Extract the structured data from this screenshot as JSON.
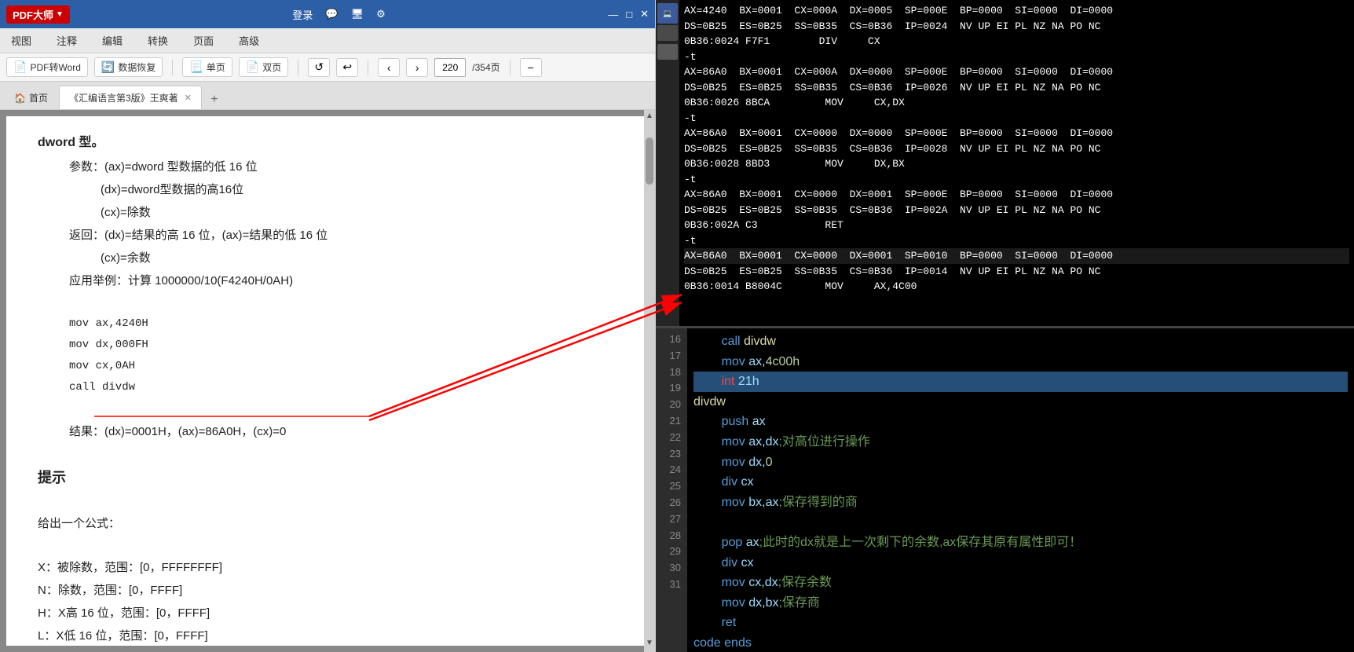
{
  "app": {
    "name": "PDF大师",
    "logo_arrow": "▼"
  },
  "toolbar_top": {
    "login": "登录",
    "chat": "💬",
    "screenshot": "🖥",
    "settings": "⚙",
    "minimize": "—",
    "maximize": "□",
    "close": "✕"
  },
  "menubar": {
    "items": [
      "视图",
      "注释",
      "编辑",
      "转换",
      "页面",
      "高级"
    ]
  },
  "actionbar": {
    "pdf_to_word": "PDF转Word",
    "data_recovery": "数据恢复",
    "single_page": "单页",
    "double_page": "双页",
    "current_page": "220",
    "total_pages": "/354页"
  },
  "tabs": {
    "home": "首页",
    "document": "《汇编语言第3版》王爽著",
    "add": "+"
  },
  "pdf_content": {
    "lines": [
      {
        "text": "dword 型。",
        "style": "bold"
      },
      {
        "text": "参数：(ax)=dword 型数据的低 16 位",
        "style": "indent1"
      },
      {
        "text": "(dx)=dword型数据的高16位",
        "style": "indent2"
      },
      {
        "text": "(cx)=除数",
        "style": "indent2"
      },
      {
        "text": "返回：(dx)=结果的高 16 位，(ax)=结果的低 16 位",
        "style": "indent1"
      },
      {
        "text": "(cx)=余数",
        "style": "indent2"
      },
      {
        "text": "应用举例：计算 1000000/10(F4240H/0AH)",
        "style": "indent1"
      },
      {
        "text": "mov  ax,4240H",
        "style": "code indent1"
      },
      {
        "text": "mov  dx,000FH",
        "style": "code indent1"
      },
      {
        "text": "mov  cx,0AH",
        "style": "code indent1"
      },
      {
        "text": "call divdw",
        "style": "code indent1"
      },
      {
        "text": "结果：(dx)=0001H，(ax)=86A0H，(cx)=0",
        "style": "indent1"
      },
      {
        "text": "提示",
        "style": "bold heading"
      },
      {
        "text": "给出一个公式：",
        "style": "normal"
      },
      {
        "text": "X：被除数，范围：[0，FFFFFFFF]",
        "style": "normal"
      },
      {
        "text": "N：除数，范围：[0，FFFF]",
        "style": "normal"
      },
      {
        "text": "H：X高 16 位，范围：[0，FFFF]",
        "style": "normal"
      },
      {
        "text": "L：X低 16 位，范围：[0，FFFF]",
        "style": "normal"
      }
    ]
  },
  "debugger": {
    "blocks": [
      {
        "line1": "AX=4240  BX=0001  CX=000A  DX=0005  SP=000E  BP=0000  SI=0000  DI=0000",
        "line2": "DS=0B25  ES=0B25  SS=0B35  CS=0B36  IP=0024  NV UP EI PL NZ NA PO NC",
        "line3": "0B36:0024 F7F1        DIV     CX",
        "prompt": "-t"
      },
      {
        "line1": "AX=86A0  BX=0001  CX=000A  DX=0000  SP=000E  BP=0000  SI=0000  DI=0000",
        "line2": "DS=0B25  ES=0B25  SS=0B35  CS=0B36  IP=0026  NV UP EI PL NZ NA PO NC",
        "line3": "0B36:0026 8BCA         MOV     CX,DX",
        "prompt": "-t"
      },
      {
        "line1": "AX=86A0  BX=0001  CX=0000  DX=0000  SP=000E  BP=0000  SI=0000  DI=0000",
        "line2": "DS=0B25  ES=0B25  SS=0B35  CS=0B36  IP=0028  NV UP EI PL NZ NA PO NC",
        "line3": "0B36:0028 8BD3         MOV     DX,BX",
        "prompt": "-t"
      },
      {
        "line1": "AX=86A0  BX=0001  CX=0000  DX=0001  SP=000E  BP=0000  SI=0000  DI=0000",
        "line2": "DS=0B25  ES=0B25  SS=0B35  CS=0B36  IP=002A  NV UP EI PL NZ NA PO NC",
        "line3": "0B36:002A C3           RET",
        "prompt": "-t"
      },
      {
        "line1": "AX=86A0  BX=0001  CX=0000  DX=0001  SP=0010  BP=0000  SI=0000  DI=0000",
        "line2": "DS=0B25  ES=0B25  SS=0B35  CS=0B36  IP=0014  NV UP EI PL NZ NA PO NC",
        "line3": "0B36:0014 B8004C       MOV     AX,4C00",
        "prompt": ""
      }
    ]
  },
  "code_editor": {
    "lines": [
      {
        "num": "16",
        "content": "        call divdw",
        "highlight": false,
        "parts": [
          {
            "text": "        ",
            "cls": ""
          },
          {
            "text": "call",
            "cls": "kw-blue"
          },
          {
            "text": " divdw",
            "cls": "kw-yellow"
          }
        ]
      },
      {
        "num": "17",
        "content": "        mov ax,4c00h",
        "highlight": false,
        "parts": [
          {
            "text": "        ",
            "cls": ""
          },
          {
            "text": "mov",
            "cls": "kw-blue"
          },
          {
            "text": " ax,",
            "cls": "kw-cyan"
          },
          {
            "text": "4c00h",
            "cls": "kw-number"
          }
        ]
      },
      {
        "num": "18",
        "content": "        int 21h",
        "highlight": true,
        "parts": [
          {
            "text": "        ",
            "cls": ""
          },
          {
            "text": "int",
            "cls": "kw-red"
          },
          {
            "text": " 21h",
            "cls": "kw-number"
          }
        ]
      },
      {
        "num": "19",
        "content": "divdw:",
        "highlight": false,
        "parts": [
          {
            "text": "divdw",
            "cls": "kw-yellow"
          },
          {
            "text": ":",
            "cls": ""
          }
        ]
      },
      {
        "num": "20",
        "content": "        push ax",
        "highlight": false,
        "parts": [
          {
            "text": "        ",
            "cls": ""
          },
          {
            "text": "push",
            "cls": "kw-blue"
          },
          {
            "text": " ax",
            "cls": "kw-cyan"
          }
        ]
      },
      {
        "num": "21",
        "content": "        mov ax,dx;对高位进行操作",
        "highlight": false,
        "parts": [
          {
            "text": "        ",
            "cls": ""
          },
          {
            "text": "mov",
            "cls": "kw-blue"
          },
          {
            "text": " ax,dx",
            "cls": "kw-cyan"
          },
          {
            "text": ";对高位进行操作",
            "cls": "kw-comment"
          }
        ]
      },
      {
        "num": "22",
        "content": "        mov dx,0",
        "highlight": false,
        "parts": [
          {
            "text": "        ",
            "cls": ""
          },
          {
            "text": "mov",
            "cls": "kw-blue"
          },
          {
            "text": " dx,",
            "cls": "kw-cyan"
          },
          {
            "text": "0",
            "cls": "kw-number"
          }
        ]
      },
      {
        "num": "23",
        "content": "        div cx",
        "highlight": false,
        "parts": [
          {
            "text": "        ",
            "cls": ""
          },
          {
            "text": "div",
            "cls": "kw-blue"
          },
          {
            "text": " cx",
            "cls": "kw-cyan"
          }
        ]
      },
      {
        "num": "24",
        "content": "        mov bx,ax;保存得到的商",
        "highlight": false,
        "parts": [
          {
            "text": "        ",
            "cls": ""
          },
          {
            "text": "mov",
            "cls": "kw-blue"
          },
          {
            "text": " bx,ax",
            "cls": "kw-cyan"
          },
          {
            "text": ";保存得到的商",
            "cls": "kw-comment"
          }
        ]
      },
      {
        "num": "25",
        "content": "",
        "highlight": false,
        "parts": []
      },
      {
        "num": "26",
        "content": "        pop ax;此时的dx就是上一次剩下的余数,ax保存其原有属性即可！",
        "highlight": false,
        "parts": [
          {
            "text": "        ",
            "cls": ""
          },
          {
            "text": "pop",
            "cls": "kw-blue"
          },
          {
            "text": " ax",
            "cls": "kw-cyan"
          },
          {
            "text": ";此时的dx就是上一次剩下的余数,ax保存其原有属性即可！",
            "cls": "kw-comment"
          }
        ]
      },
      {
        "num": "27",
        "content": "        div cx",
        "highlight": false,
        "parts": [
          {
            "text": "        ",
            "cls": ""
          },
          {
            "text": "div",
            "cls": "kw-blue"
          },
          {
            "text": " cx",
            "cls": "kw-cyan"
          }
        ]
      },
      {
        "num": "28",
        "content": "        mov cx,dx;保存余数",
        "highlight": false,
        "parts": [
          {
            "text": "        ",
            "cls": ""
          },
          {
            "text": "mov",
            "cls": "kw-blue"
          },
          {
            "text": " cx,dx",
            "cls": "kw-cyan"
          },
          {
            "text": ";保存余数",
            "cls": "kw-comment"
          }
        ]
      },
      {
        "num": "29",
        "content": "        mov dx,bx;保存商",
        "highlight": false,
        "parts": [
          {
            "text": "        ",
            "cls": ""
          },
          {
            "text": "mov",
            "cls": "kw-blue"
          },
          {
            "text": " dx,bx",
            "cls": "kw-cyan"
          },
          {
            "text": ";保存商",
            "cls": "kw-comment"
          }
        ]
      },
      {
        "num": "30",
        "content": "        ret",
        "highlight": false,
        "parts": [
          {
            "text": "        ",
            "cls": ""
          },
          {
            "text": "ret",
            "cls": "kw-blue"
          }
        ]
      },
      {
        "num": "31",
        "content": "code ends",
        "highlight": false,
        "parts": [
          {
            "text": "code",
            "cls": "kw-blue"
          },
          {
            "text": " ",
            "cls": ""
          },
          {
            "text": "ends",
            "cls": "kw-blue"
          }
        ]
      }
    ]
  }
}
